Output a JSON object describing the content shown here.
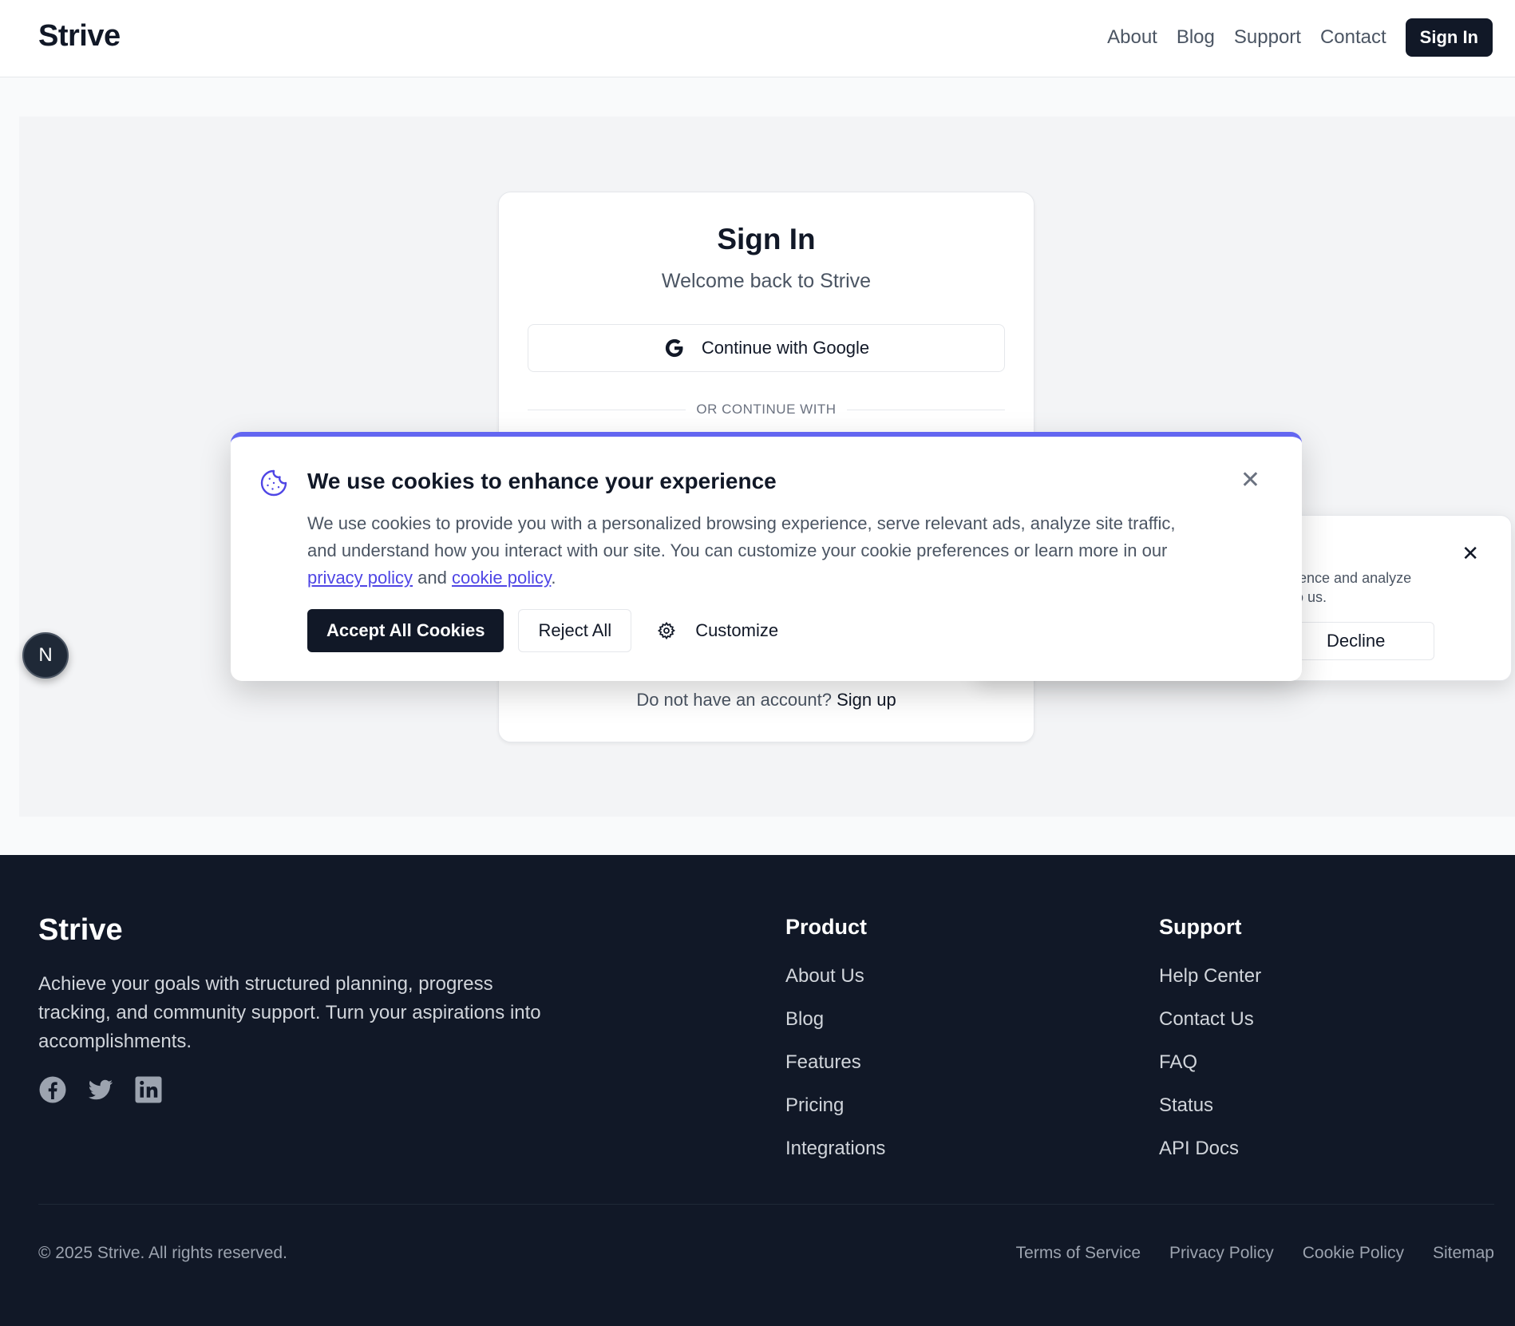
{
  "header": {
    "brand": "Strive",
    "nav": [
      "About",
      "Blog",
      "Support",
      "Contact"
    ],
    "signin_label": "Sign In"
  },
  "card": {
    "title": "Sign In",
    "subtitle": "Welcome back to Strive",
    "google_label": "Continue with Google",
    "divider": "OR CONTINUE WITH",
    "footer_text": "Do not have an account?",
    "signup_label": "Sign up"
  },
  "badge": {
    "letter": "N"
  },
  "popup2": {
    "text_line1": "ience and analyze",
    "text_line2": "o us.",
    "decline_label": "Decline",
    "close_glyph": "✕"
  },
  "cookie": {
    "title": "We use cookies to enhance your experience",
    "body_prefix": "We use cookies to provide you with a personalized browsing experience, serve relevant ads, analyze site traffic, and understand how you interact with our site. You can customize your cookie preferences or learn more in our",
    "privacy_link": "privacy policy",
    "and_text": "and",
    "cookie_link": "cookie policy",
    "end_punct": ".",
    "accept_label": "Accept All Cookies",
    "reject_label": "Reject All",
    "customize_label": "Customize",
    "close_glyph": "✕",
    "accent_color": "#6366f1"
  },
  "footer": {
    "brand": "Strive",
    "description": "Achieve your goals with structured planning, progress tracking, and community support. Turn your aspirations into accomplishments.",
    "socials": [
      "facebook-icon",
      "twitter-icon",
      "linkedin-icon"
    ],
    "product": {
      "heading": "Product",
      "links": [
        "About Us",
        "Blog",
        "Features",
        "Pricing",
        "Integrations"
      ]
    },
    "support": {
      "heading": "Support",
      "links": [
        "Help Center",
        "Contact Us",
        "FAQ",
        "Status",
        "API Docs"
      ]
    },
    "copyright": "© 2025 Strive. All rights reserved.",
    "legal": [
      "Terms of Service",
      "Privacy Policy",
      "Cookie Policy",
      "Sitemap"
    ]
  },
  "colors": {
    "primary_dark": "#111827",
    "accent": "#6366f1",
    "link": "#4f46e5"
  }
}
